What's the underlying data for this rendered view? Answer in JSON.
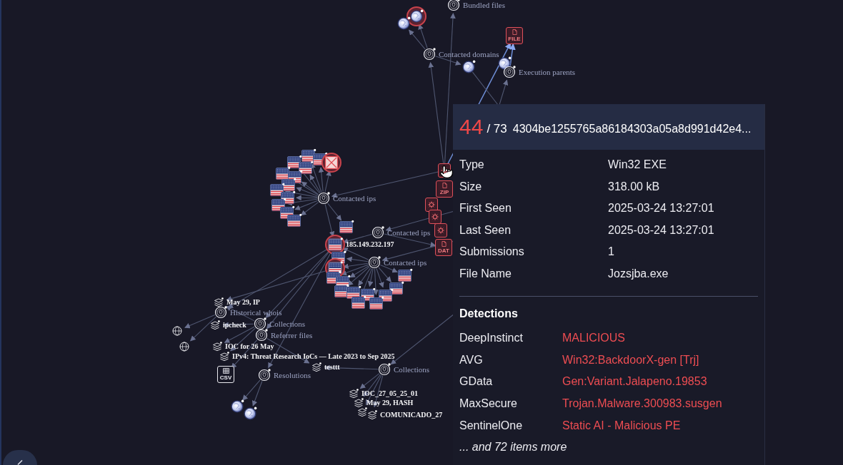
{
  "graph": {
    "nodes": [
      {
        "kind": "relation",
        "label": "Bundled files",
        "flagged": false
      },
      {
        "kind": "globe",
        "flagged": true
      },
      {
        "kind": "globe",
        "flagged": false
      },
      {
        "kind": "relation",
        "label": "Contacted domains",
        "flagged": false
      },
      {
        "kind": "globe",
        "flagged": false
      },
      {
        "kind": "file",
        "badge": "FILE",
        "flagged": false
      },
      {
        "kind": "globe",
        "flagged": false
      },
      {
        "kind": "relation",
        "label": "Execution parents",
        "flagged": false
      },
      {
        "kind": "relation",
        "label": "Contacted ips",
        "flagged": false
      },
      {
        "kind": "flag",
        "flagged": false
      },
      {
        "kind": "flag",
        "flagged": false
      },
      {
        "kind": "flag",
        "flagged": false
      },
      {
        "kind": "flag",
        "flagged": false
      },
      {
        "kind": "flag",
        "flagged": false
      },
      {
        "kind": "flag",
        "flagged": false
      },
      {
        "kind": "flag",
        "flagged": false
      },
      {
        "kind": "flag",
        "flagged": false
      },
      {
        "kind": "flag",
        "flagged": false
      },
      {
        "kind": "flag",
        "flagged": false
      },
      {
        "kind": "flag",
        "flagged": false
      },
      {
        "kind": "flag",
        "flagged": false
      },
      {
        "kind": "cross",
        "flagged": true
      },
      {
        "kind": "flag",
        "flagged": false
      },
      {
        "kind": "relation",
        "label": "Contacted ips",
        "flagged": false
      },
      {
        "kind": "flag",
        "label": "185.149.232.197",
        "flagged": true
      },
      {
        "kind": "flag",
        "flagged": false
      },
      {
        "kind": "flag",
        "flagged": true
      },
      {
        "kind": "relation",
        "label": "Contacted ips",
        "flagged": false
      },
      {
        "kind": "flag",
        "flagged": false
      },
      {
        "kind": "flag",
        "flagged": false
      },
      {
        "kind": "flag",
        "flagged": false
      },
      {
        "kind": "flag",
        "flagged": false
      },
      {
        "kind": "flag",
        "flagged": false
      },
      {
        "kind": "flag",
        "flagged": false
      },
      {
        "kind": "flag",
        "flagged": false
      },
      {
        "kind": "flag",
        "flagged": false
      },
      {
        "kind": "flag",
        "flagged": false
      },
      {
        "kind": "flag",
        "flagged": false
      },
      {
        "kind": "file",
        "flagged": false
      },
      {
        "kind": "file",
        "badge": "ZIP",
        "flagged": false
      },
      {
        "kind": "file",
        "flagged": false
      },
      {
        "kind": "file",
        "flagged": false
      },
      {
        "kind": "file",
        "flagged": false
      },
      {
        "kind": "file",
        "badge": "DAT",
        "flagged": false
      },
      {
        "kind": "collection",
        "label": "May 29, IP",
        "flagged": false
      },
      {
        "kind": "relation",
        "label": "Historical whois",
        "flagged": false
      },
      {
        "kind": "relation",
        "label": "Collections",
        "flagged": false
      },
      {
        "kind": "collection",
        "label": "ipcheck",
        "flagged": false
      },
      {
        "kind": "relation",
        "label": "Referrer files",
        "flagged": false
      },
      {
        "kind": "collection",
        "label": "IOC for 26 May",
        "flagged": false
      },
      {
        "kind": "collection",
        "label": "IPv4: Threat Research IoCs — Late 2023 to Sep 2025",
        "flagged": false
      },
      {
        "kind": "web",
        "flagged": false
      },
      {
        "kind": "web",
        "flagged": false
      },
      {
        "kind": "csv",
        "badge": "CSV",
        "flagged": false
      },
      {
        "kind": "relation",
        "label": "Resolutions",
        "flagged": false
      },
      {
        "kind": "globe",
        "flagged": false
      },
      {
        "kind": "globe",
        "flagged": false
      },
      {
        "kind": "collection",
        "label": "testtt",
        "flagged": false
      },
      {
        "kind": "relation",
        "label": "Collections",
        "flagged": false
      },
      {
        "kind": "collection",
        "label": "IOC_27_05_25_01",
        "flagged": false
      },
      {
        "kind": "collection",
        "label": "May 29, HASH",
        "flagged": false
      },
      {
        "kind": "collection",
        "flagged": false
      },
      {
        "kind": "collection",
        "label": "COMUNICADO_27",
        "flagged": false
      }
    ]
  },
  "tooltip": {
    "score": "44",
    "total": "/ 73",
    "hash": "4304be1255765a86184303a05a8d991d42e4...",
    "properties": [
      {
        "label": "Type",
        "value": "Win32 EXE"
      },
      {
        "label": "Size",
        "value": "318.00 kB"
      },
      {
        "label": "First Seen",
        "value": "2025-03-24 13:27:01"
      },
      {
        "label": "Last Seen",
        "value": "2025-03-24 13:27:01"
      },
      {
        "label": "Submissions",
        "value": "1"
      },
      {
        "label": "File Name",
        "value": "Jozsjba.exe"
      }
    ],
    "detections_title": "Detections",
    "detections": [
      {
        "engine": "DeepInstinct",
        "result": "MALICIOUS"
      },
      {
        "engine": "AVG",
        "result": "Win32:BackdoorX-gen [Trj]"
      },
      {
        "engine": "GData",
        "result": "Gen:Variant.Jalapeno.19853"
      },
      {
        "engine": "MaxSecure",
        "result": "Trojan.Malware.300983.susgen"
      },
      {
        "engine": "SentinelOne",
        "result": "Static AI - Malicious PE"
      }
    ],
    "more": "... and 72 items more"
  }
}
